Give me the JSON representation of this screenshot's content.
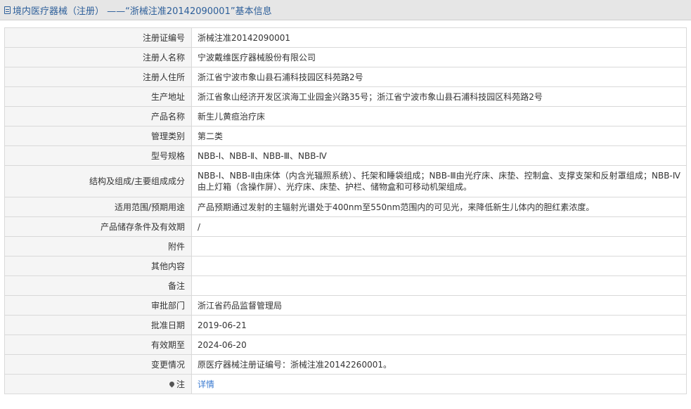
{
  "header": {
    "title": "境内医疗器械（注册） ——“浙械注准20142090001”基本信息",
    "icon": "document-icon",
    "color": "#2d5f9a"
  },
  "rows": [
    {
      "label": "注册证编号",
      "value": "浙械注准20142090001"
    },
    {
      "label": "注册人名称",
      "value": "宁波戴维医疗器械股份有限公司"
    },
    {
      "label": "注册人住所",
      "value": "浙江省宁波市象山县石浦科技园区科苑路2号"
    },
    {
      "label": "生产地址",
      "value": "浙江省象山经济开发区滨海工业园金兴路35号；浙江省宁波市象山县石浦科技园区科苑路2号"
    },
    {
      "label": "产品名称",
      "value": "新生儿黄疸治疗床"
    },
    {
      "label": "管理类别",
      "value": "第二类"
    },
    {
      "label": "型号规格",
      "value": "NBB-Ⅰ、NBB-Ⅱ、NBB-Ⅲ、NBB-Ⅳ"
    },
    {
      "label": "结构及组成/主要组成成分",
      "value": "NBB-Ⅰ、NBB-Ⅱ由床体（内含光辐照系统）、托架和睡袋组成；NBB-Ⅲ由光疗床、床垫、控制盒、支撑支架和反射罩组成；NBB-Ⅳ由上灯箱（含操作屏）、光疗床、床垫、护栏、储物盒和可移动机架组成。"
    },
    {
      "label": "适用范围/预期用途",
      "value": "产品预期通过发射的主辐射光谱处于400nm至550nm范围内的可见光，来降低新生儿体内的胆红素浓度。"
    },
    {
      "label": "产品储存条件及有效期",
      "value": "/"
    },
    {
      "label": "附件",
      "value": ""
    },
    {
      "label": "其他内容",
      "value": ""
    },
    {
      "label": "备注",
      "value": ""
    },
    {
      "label": "审批部门",
      "value": "浙江省药品监督管理局"
    },
    {
      "label": "批准日期",
      "value": "2019-06-21"
    },
    {
      "label": "有效期至",
      "value": "2024-06-20"
    },
    {
      "label": "变更情况",
      "value": "原医疗器械注册证编号：浙械注准20142260001。"
    }
  ],
  "note": {
    "label": "注",
    "icon": "pin-icon",
    "link_text": "详情",
    "link_color": "#3a7ad0"
  }
}
